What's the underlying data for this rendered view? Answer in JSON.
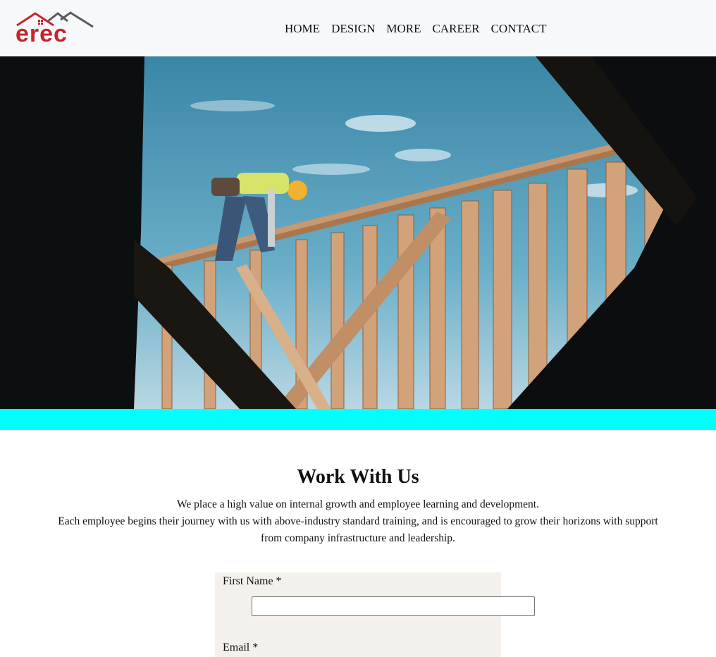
{
  "header": {
    "logo_text": "erec",
    "nav": [
      "HOME",
      "DESIGN",
      "MORE",
      "CAREER",
      "CONTACT"
    ]
  },
  "colors": {
    "accent_bar": "#00ffff",
    "logo_red": "#c8242c",
    "logo_gray": "#5a5a5a",
    "form_bg": "#f4f1ec"
  },
  "main": {
    "title": "Work With Us",
    "description_line1": "We place a high value on internal growth and employee learning and development.",
    "description_line2": "Each employee begins their journey with us with above-industry standard training, and is encouraged to grow their horizons with support from company infrastructure and leadership."
  },
  "form": {
    "first_name_label": "First Name *",
    "first_name_value": "",
    "email_label": "Email *"
  }
}
